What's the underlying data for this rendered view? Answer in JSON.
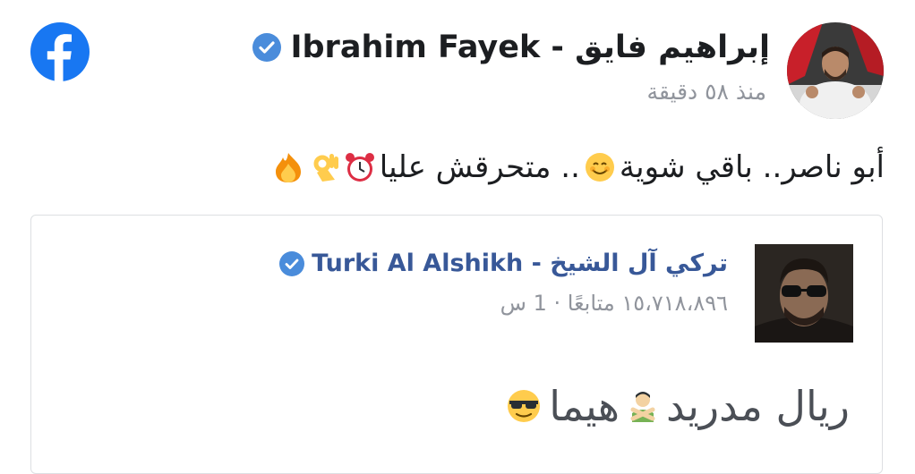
{
  "colors": {
    "facebook_blue": "#1877f2",
    "verified_blue": "#4a8cdb",
    "link_blue": "#385898",
    "meta_gray": "#90949c"
  },
  "header": {
    "logo_icon": "facebook-logo-icon",
    "author_name": "Ibrahim Fayek - إبراهيم فايق",
    "verified_icon": "verified-badge-icon",
    "timestamp": "منذ ٥٨ دقيقة"
  },
  "post": {
    "text": "أبو ناصر.. باقي شوية",
    "text_after_emoji": ".. متحرقش عليا",
    "emojis": [
      "smiling-face-icon",
      "alarm-clock-icon",
      "ok-hand-icon",
      "fire-icon"
    ]
  },
  "shared_post": {
    "author_name": "Turki Al Alshikh - تركي آل الشيخ",
    "verified_icon": "verified-badge-icon",
    "meta": "١٥،٧١٨،٨٩٦ متابعًا · 1 س",
    "text": "ريال مدريد",
    "text_2": "هيما",
    "emojis": [
      "man-gesturing-no-icon",
      "sunglasses-face-icon"
    ]
  }
}
